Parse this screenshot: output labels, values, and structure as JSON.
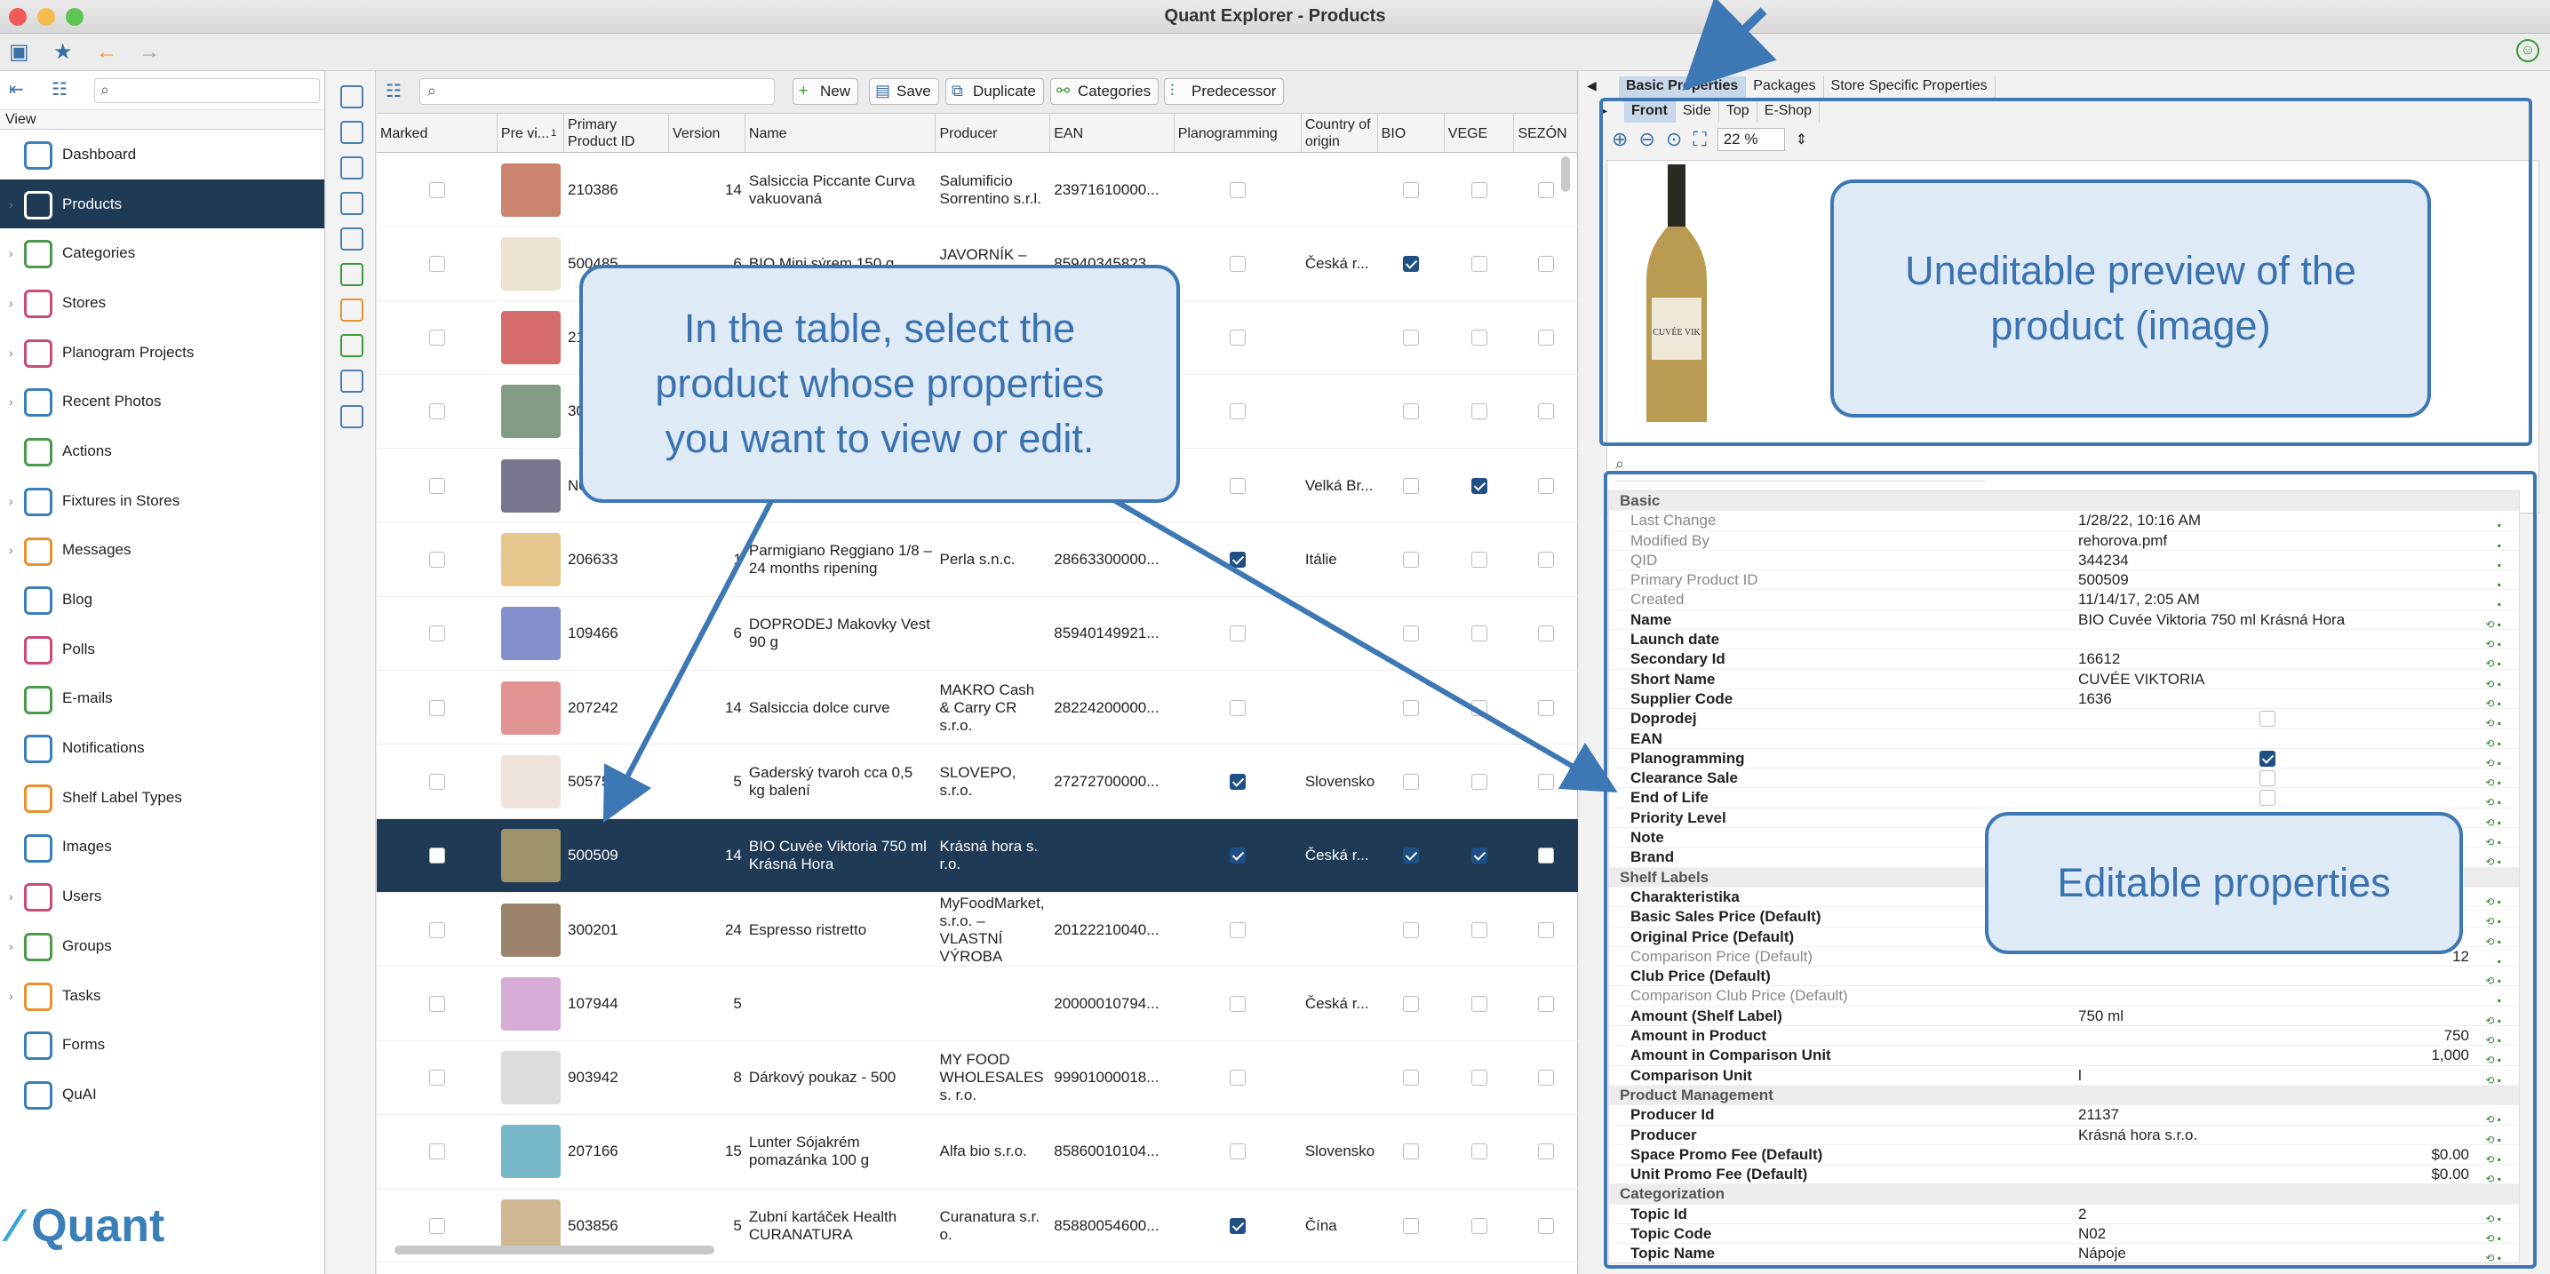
{
  "window": {
    "title": "Quant Explorer - Products"
  },
  "sidebar": {
    "view_label": "View",
    "logo_text": "Quant",
    "items": [
      {
        "label": "Dashboard",
        "icon": "dashboard-icon",
        "has_children": false,
        "color": "#3b7fb8"
      },
      {
        "label": "Products",
        "icon": "products-icon",
        "has_children": true,
        "active": true,
        "color": "#ffffff"
      },
      {
        "label": "Categories",
        "icon": "categories-icon",
        "has_children": true,
        "color": "#4a9a4a"
      },
      {
        "label": "Stores",
        "icon": "stores-icon",
        "has_children": true,
        "color": "#c84b7a"
      },
      {
        "label": "Planogram Projects",
        "icon": "planogram-icon",
        "has_children": true,
        "color": "#c84b7a"
      },
      {
        "label": "Recent Photos",
        "icon": "camera-icon",
        "has_children": true,
        "color": "#3b7fb8"
      },
      {
        "label": "Actions",
        "icon": "actions-icon",
        "has_children": false,
        "color": "#4a9a4a"
      },
      {
        "label": "Fixtures in Stores",
        "icon": "fixtures-icon",
        "has_children": true,
        "color": "#3b7fb8"
      },
      {
        "label": "Messages",
        "icon": "messages-icon",
        "has_children": true,
        "color": "#e8912d"
      },
      {
        "label": "Blog",
        "icon": "blog-icon",
        "has_children": false,
        "color": "#3b7fb8"
      },
      {
        "label": "Polls",
        "icon": "polls-icon",
        "has_children": false,
        "color": "#c84b7a"
      },
      {
        "label": "E-mails",
        "icon": "email-icon",
        "has_children": false,
        "color": "#4a9a4a"
      },
      {
        "label": "Notifications",
        "icon": "notifications-icon",
        "has_children": false,
        "color": "#3b7fb8"
      },
      {
        "label": "Shelf Label Types",
        "icon": "shelf-label-icon",
        "has_children": false,
        "color": "#e8912d"
      },
      {
        "label": "Images",
        "icon": "images-icon",
        "has_children": false,
        "color": "#3b7fb8"
      },
      {
        "label": "Users",
        "icon": "users-icon",
        "has_children": true,
        "color": "#c84b7a"
      },
      {
        "label": "Groups",
        "icon": "groups-icon",
        "has_children": true,
        "color": "#4a9a4a"
      },
      {
        "label": "Tasks",
        "icon": "tasks-icon",
        "has_children": true,
        "color": "#e8912d"
      },
      {
        "label": "Forms",
        "icon": "forms-icon",
        "has_children": false,
        "color": "#3b7fb8"
      },
      {
        "label": "QuAI",
        "icon": "quai-icon",
        "has_children": false,
        "color": "#3b7fb8"
      }
    ]
  },
  "table": {
    "toolbar": {
      "new": "New",
      "save": "Save",
      "duplicate": "Duplicate",
      "categories": "Categories",
      "predecessor": "Predecessor"
    },
    "columns": [
      {
        "label": "Marked"
      },
      {
        "label": "Pre vi...",
        "sort": "1"
      },
      {
        "label": "Primary Product ID"
      },
      {
        "label": "Version"
      },
      {
        "label": "Name"
      },
      {
        "label": "Producer"
      },
      {
        "label": "EAN"
      },
      {
        "label": "Planogramming"
      },
      {
        "label": "Country of origin"
      },
      {
        "label": "BIO"
      },
      {
        "label": "VEGE"
      },
      {
        "label": "SEZÓN"
      }
    ],
    "rows": [
      {
        "id": "210386",
        "version": "14",
        "name": "Salsiccia Piccante Curva vakuovaná",
        "producer": "Salumificio Sorrentino s.r.l.",
        "ean": "23971610000...",
        "plan": false,
        "country": "",
        "bio": false,
        "vege": false,
        "thumb": "#b85a3c"
      },
      {
        "id": "500485",
        "version": "6",
        "name": "BIO Mini sýrem 150 g",
        "producer": "JAVORNÍK – CZ",
        "ean": "85940345823...",
        "plan": false,
        "country": "Česká r...",
        "bio": true,
        "vege": false,
        "thumb": "#e6d8c0"
      },
      {
        "id": "21",
        "version": "",
        "name": "",
        "producer": "",
        "ean": "",
        "plan": false,
        "country": "",
        "bio": false,
        "vege": false,
        "thumb": "#c83a3a"
      },
      {
        "id": "30",
        "version": "",
        "name": "",
        "producer": "",
        "ean": "",
        "plan": false,
        "country": "",
        "bio": false,
        "vege": false,
        "thumb": "#5a7a5a"
      },
      {
        "id": "N01",
        "version": "",
        "name": "",
        "producer": "",
        "ean": "",
        "plan": false,
        "country": "Velká Br...",
        "bio": false,
        "vege": true,
        "thumb": "#4a4a6a"
      },
      {
        "id": "206633",
        "version": "1",
        "name": "Parmigiano Reggiano 1/8 – 24 months ripening",
        "producer": "Perla s.n.c.",
        "ean": "28663300000...",
        "plan": true,
        "country": "Itálie",
        "bio": false,
        "vege": false,
        "thumb": "#e0b468"
      },
      {
        "id": "109466",
        "version": "6",
        "name": "DOPRODEJ Makovky Vest 90 g",
        "producer": "",
        "ean": "85940149921...",
        "plan": false,
        "country": "",
        "bio": false,
        "vege": false,
        "thumb": "#5a6ab8"
      },
      {
        "id": "207242",
        "version": "14",
        "name": "Salsiccia dolce curve",
        "producer": "MAKRO Cash & Carry CR s.r.o.",
        "ean": "28224200000...",
        "plan": false,
        "country": "",
        "bio": false,
        "vege": false,
        "thumb": "#d87070"
      },
      {
        "id": "505751",
        "version": "5",
        "name": "Gaderský tvaroh cca 0,5 kg balení",
        "producer": "SLOVEPO, s.r.o.",
        "ean": "27272700000...",
        "plan": true,
        "country": "Slovensko",
        "bio": false,
        "vege": false,
        "thumb": "#eadbd0"
      },
      {
        "id": "500509",
        "version": "14",
        "name": "BIO Cuvée Viktoria 750 ml Krásná Hora",
        "producer": "Krásná hora s. r.o.",
        "ean": "",
        "plan": true,
        "country": "Česká r...",
        "bio": true,
        "vege": true,
        "thumb": "#c8b070",
        "selected": true
      },
      {
        "id": "300201",
        "version": "24",
        "name": "Espresso ristretto",
        "producer": "MyFoodMarket, s.r.o. – VLASTNÍ VÝROBA",
        "ean": "20122210040...",
        "plan": false,
        "country": "",
        "bio": false,
        "vege": false,
        "thumb": "#7a5a3a"
      },
      {
        "id": "107944",
        "version": "5",
        "name": "",
        "producer": "",
        "ean": "20000010794...",
        "plan": false,
        "country": "Česká r...",
        "bio": false,
        "vege": false,
        "thumb": "#c890c8"
      },
      {
        "id": "903942",
        "version": "8",
        "name": "Dárkový poukaz - 500",
        "producer": "MY FOOD WHOLESALES s. r.o.",
        "ean": "99901000018...",
        "plan": false,
        "country": "",
        "bio": false,
        "vege": false,
        "thumb": "#d0d0d0"
      },
      {
        "id": "207166",
        "version": "15",
        "name": "Lunter Sójakrém pomazánka 100 g",
        "producer": "Alfa bio s.r.o.",
        "ean": "85860010104...",
        "plan": false,
        "country": "Slovensko",
        "bio": false,
        "vege": false,
        "thumb": "#4aa0b8"
      },
      {
        "id": "503856",
        "version": "5",
        "name": "Zubní kartáček Health CURANATURA",
        "producer": "Curanatura s.r. o.",
        "ean": "85880054600...",
        "plan": true,
        "country": "Čína",
        "bio": false,
        "vege": false,
        "thumb": "#c0a070"
      }
    ]
  },
  "details": {
    "tabs": [
      "Basic Properties",
      "Packages",
      "Store Specific Properties"
    ],
    "view_tabs": [
      "Front",
      "Side",
      "Top",
      "E-Shop"
    ],
    "zoom": "22 %",
    "bottle_label": "CUVÉE VIK",
    "props": [
      {
        "type": "group",
        "label": "Basic"
      },
      {
        "label": "Last Change",
        "value": "1/28/22, 10:16 AM",
        "ro": true
      },
      {
        "label": "Modified By",
        "value": "rehorova.pmf",
        "ro": true
      },
      {
        "label": "QID",
        "value": "344234",
        "ro": true
      },
      {
        "label": "Primary Product ID",
        "value": "500509",
        "ro": true
      },
      {
        "label": "Created",
        "value": "11/14/17, 2:05 AM",
        "ro": true
      },
      {
        "label": "Name",
        "value": "BIO Cuvée Viktoria 750 ml Krásná Hora"
      },
      {
        "label": "Launch date",
        "value": ""
      },
      {
        "label": "Secondary Id",
        "value": "16612"
      },
      {
        "label": "Short Name",
        "value": "CUVÉE VIKTORIA"
      },
      {
        "label": "Supplier Code",
        "value": "1636"
      },
      {
        "label": "Doprodej",
        "check": false
      },
      {
        "label": "EAN",
        "value": ""
      },
      {
        "label": "Planogramming",
        "check": true
      },
      {
        "label": "Clearance Sale",
        "check": false
      },
      {
        "label": "End of Life",
        "check": false
      },
      {
        "label": "Priority Level",
        "value": ""
      },
      {
        "label": "Note",
        "value": ""
      },
      {
        "label": "Brand",
        "value": ""
      },
      {
        "type": "group",
        "label": "Shelf Labels"
      },
      {
        "label": "Charakteristika",
        "value": ""
      },
      {
        "label": "Basic Sales Price (Default)",
        "value": ""
      },
      {
        "label": "Original Price (Default)",
        "value": ""
      },
      {
        "label": "Comparison Price (Default)",
        "value": "12",
        "ro": true,
        "num": true
      },
      {
        "label": "Club Price (Default)",
        "value": ""
      },
      {
        "label": "Comparison Club Price (Default)",
        "value": "",
        "ro": true
      },
      {
        "label": "Amount (Shelf Label)",
        "value": "750 ml"
      },
      {
        "label": "Amount in Product",
        "value": "750",
        "num": true
      },
      {
        "label": "Amount in Comparison Unit",
        "value": "1,000",
        "num": true
      },
      {
        "label": "Comparison Unit",
        "value": "l"
      },
      {
        "type": "group",
        "label": "Product Management"
      },
      {
        "label": "Producer Id",
        "value": "21137"
      },
      {
        "label": "Producer",
        "value": "Krásná hora s.r.o."
      },
      {
        "label": "Space Promo Fee (Default)",
        "value": "$0.00",
        "num": true
      },
      {
        "label": "Unit Promo Fee (Default)",
        "value": "$0.00",
        "num": true
      },
      {
        "type": "group",
        "label": "Categorization"
      },
      {
        "label": "Topic Id",
        "value": "2"
      },
      {
        "label": "Topic Code",
        "value": "N02"
      },
      {
        "label": "Topic Name",
        "value": "Nápoje"
      }
    ]
  },
  "annotations": {
    "select_product": "In the table, select the product whose properties you want to view or edit.",
    "preview": "Uneditable preview of the product (image)",
    "editable": "Editable properties"
  },
  "colors": {
    "accent": "#3d78b5",
    "selection": "#1e3a55"
  }
}
